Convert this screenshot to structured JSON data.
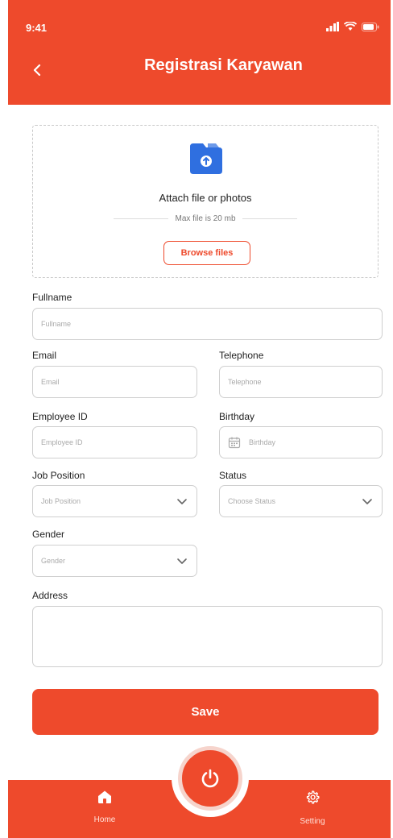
{
  "status_bar": {
    "time": "9:41"
  },
  "header": {
    "title": "Registrasi Karyawan"
  },
  "upload": {
    "title": "Attach file or photos",
    "max_file": "Max file is 20 mb",
    "browse_label": "Browse files"
  },
  "form": {
    "fullname": {
      "label": "Fullname",
      "placeholder": "Fullname"
    },
    "email": {
      "label": "Email",
      "placeholder": "Email"
    },
    "telephone": {
      "label": "Telephone",
      "placeholder": "Telephone"
    },
    "employee_id": {
      "label": "Employee ID",
      "placeholder": "Employee ID"
    },
    "birthday": {
      "label": "Birthday",
      "placeholder": "Birthday"
    },
    "job_position": {
      "label": "Job Position",
      "placeholder": "Job Position"
    },
    "status": {
      "label": "Status",
      "placeholder": "Choose Status"
    },
    "gender": {
      "label": "Gender",
      "placeholder": "Gender"
    },
    "address": {
      "label": "Address",
      "placeholder": ""
    }
  },
  "save_label": "Save",
  "bottom_nav": {
    "home_label": "Home",
    "setting_label": "Setting",
    "center_icon": "power-icon"
  },
  "colors": {
    "primary": "#ee4a2c",
    "upload_icon": "#2f6fe0"
  }
}
